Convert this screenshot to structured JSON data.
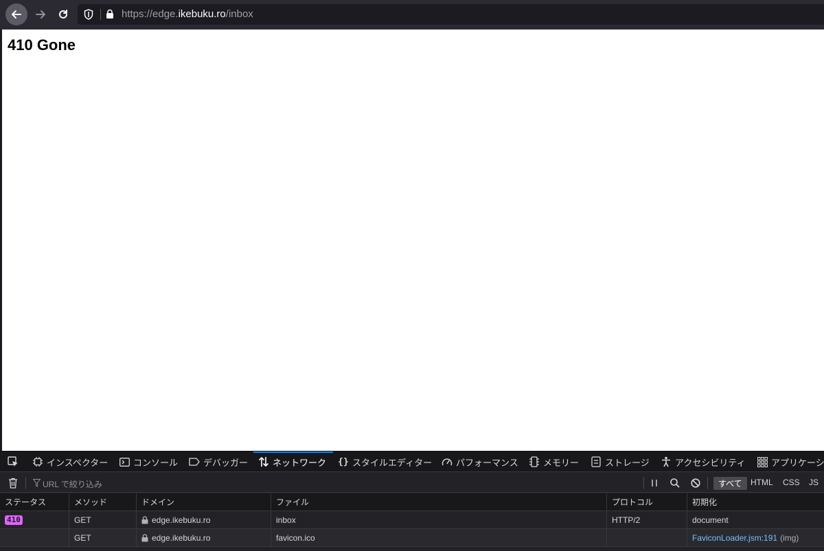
{
  "browser": {
    "url_prefix": "https://edge.",
    "url_host": "ikebuku.ro",
    "url_path": "/inbox"
  },
  "page": {
    "heading": "410 Gone"
  },
  "devtools": {
    "tabs": [
      {
        "label": "インスペクター",
        "icon": "inspector-icon"
      },
      {
        "label": "コンソール",
        "icon": "console-icon"
      },
      {
        "label": "デバッガー",
        "icon": "debugger-icon"
      },
      {
        "label": "ネットワーク",
        "icon": "network-icon",
        "active": true
      },
      {
        "label": "スタイルエディター",
        "icon": "style-editor-icon"
      },
      {
        "label": "パフォーマンス",
        "icon": "performance-icon"
      },
      {
        "label": "メモリー",
        "icon": "memory-icon"
      },
      {
        "label": "ストレージ",
        "icon": "storage-icon"
      },
      {
        "label": "アクセシビリティ",
        "icon": "accessibility-icon"
      },
      {
        "label": "アプリケーシ",
        "icon": "application-icon"
      }
    ],
    "filter_placeholder": "URL で絞り込み",
    "type_filters": [
      "すべて",
      "HTML",
      "CSS",
      "JS"
    ],
    "columns": {
      "status": "ステータス",
      "method": "メソッド",
      "domain": "ドメイン",
      "file": "ファイル",
      "protocol": "プロトコル",
      "initiator": "初期化"
    },
    "rows": [
      {
        "status": "410",
        "method": "GET",
        "domain": "edge.ikebuku.ro",
        "file": "inbox",
        "protocol": "HTTP/2",
        "initiator": "document",
        "initiator_extra": ""
      },
      {
        "status": "",
        "method": "GET",
        "domain": "edge.ikebuku.ro",
        "file": "favicon.ico",
        "protocol": "",
        "initiator": "FaviconLoader.jsm:191",
        "initiator_extra": "(img)"
      }
    ]
  },
  "colors": {
    "accent": "#0a84ff",
    "status_badge": "#e063ff",
    "link": "#75bfff"
  }
}
